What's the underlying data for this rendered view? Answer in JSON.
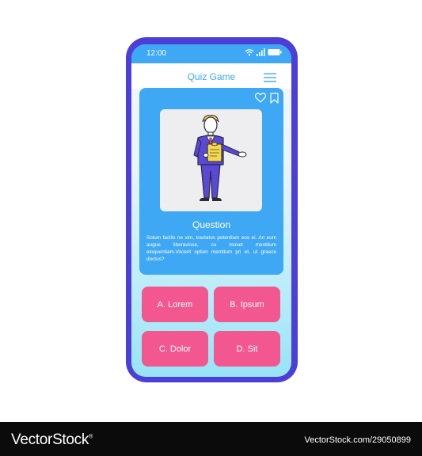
{
  "status": {
    "time": "12:00"
  },
  "app": {
    "title": "Quiz Game"
  },
  "question": {
    "title": "Question",
    "text": "Solum facilis ne vim, tractatos petentium eos ei. An eum augue liberavisse, cu movet mentitum eloquentiam.Vocent option mentitum pri et, ut graece doctus?"
  },
  "answers": [
    {
      "label": "A. Lorem"
    },
    {
      "label": "B. Ipsum"
    },
    {
      "label": "C. Dolor"
    },
    {
      "label": "D. Sit"
    }
  ],
  "icons": {
    "wifi": "wifi-icon",
    "signal": "signal-icon",
    "battery": "battery-icon",
    "menu": "hamburger-menu-icon",
    "favorite": "heart-icon",
    "bookmark": "bookmark-icon"
  },
  "colors": {
    "phone_frame": "#4b3fd8",
    "accent_blue": "#3ea8f4",
    "answer_pink": "#f2578f",
    "suit": "#5a48d6",
    "hair": "#f2c94c",
    "clipboard": "#f5d84a"
  },
  "footer": {
    "brand": "VectorStock",
    "trademark": "®",
    "image_id": "VectorStock.com/29050899"
  }
}
